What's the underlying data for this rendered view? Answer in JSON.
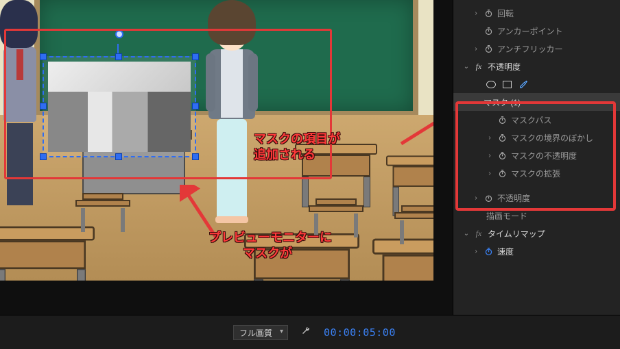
{
  "preview": {
    "mask_selected": true
  },
  "annotations": {
    "panel_note_line1": "マスクの項目が",
    "panel_note_line2": "追加される",
    "preview_note_line1": "プレビューモニターに",
    "preview_note_line2": "マスクが"
  },
  "effects": {
    "rows": {
      "rotation": "回転",
      "anchor": "アンカーポイント",
      "antiflicker": "アンチフリッカー",
      "opacity_group": "不透明度",
      "mask_group": "マスク (1)",
      "mask_path": "マスクパス",
      "mask_feather": "マスクの境界のぼかし",
      "mask_opacity": "マスクの不透明度",
      "mask_expansion": "マスクの拡張",
      "opacity": "不透明度",
      "blend_mode": "描画モード",
      "time_remap_group": "タイムリマップ",
      "speed": "速度"
    }
  },
  "footer": {
    "quality_label": "フル画質",
    "timecode": "00:00:05:00"
  }
}
